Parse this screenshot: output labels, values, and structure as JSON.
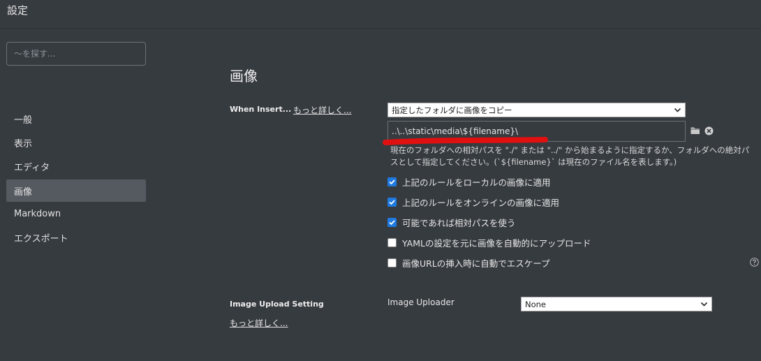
{
  "window": {
    "title": "設定"
  },
  "sidebar": {
    "search_placeholder": "〜を探す...",
    "items": [
      {
        "label": "一般"
      },
      {
        "label": "表示"
      },
      {
        "label": "エディタ"
      },
      {
        "label": "画像",
        "active": true
      },
      {
        "label": "Markdown"
      },
      {
        "label": "エクスポート"
      }
    ]
  },
  "main": {
    "title": "画像",
    "when_insert": {
      "label": "When Insert...",
      "more_link": "もっと詳しく...",
      "select_value": "指定したフォルダに画像をコピー",
      "path_value": "..\\..\\static\\media\\${filename}\\",
      "help": "現在のフォルダへの相対パスを \"./\" または \"../\" から始まるように指定するか、フォルダへの絶対パスとして指定してください。(`${filename}` は現在のファイル名を表します。)"
    },
    "checkboxes": [
      {
        "label": "上記のルールをローカルの画像に適用",
        "checked": true
      },
      {
        "label": "上記のルールをオンラインの画像に適用",
        "checked": true
      },
      {
        "label": "可能であれば相対パスを使う",
        "checked": true
      },
      {
        "label": "YAMLの設定を元に画像を自動的にアップロード",
        "checked": false
      },
      {
        "label": "画像URLの挿入時に自動でエスケープ",
        "checked": false
      }
    ],
    "upload": {
      "label": "Image Upload Setting",
      "more_link": "もっと詳しく...",
      "uploader_label": "Image Uploader",
      "uploader_value": "None"
    }
  },
  "icons": {
    "folder": "folder-icon",
    "clear": "clear-icon",
    "help": "help-icon",
    "chevron": "chevron-down-icon"
  },
  "colors": {
    "background": "#363b40",
    "active_item": "#545a60",
    "checkbox_on": "#1f7ae0",
    "annotation_red": "#e01010"
  }
}
